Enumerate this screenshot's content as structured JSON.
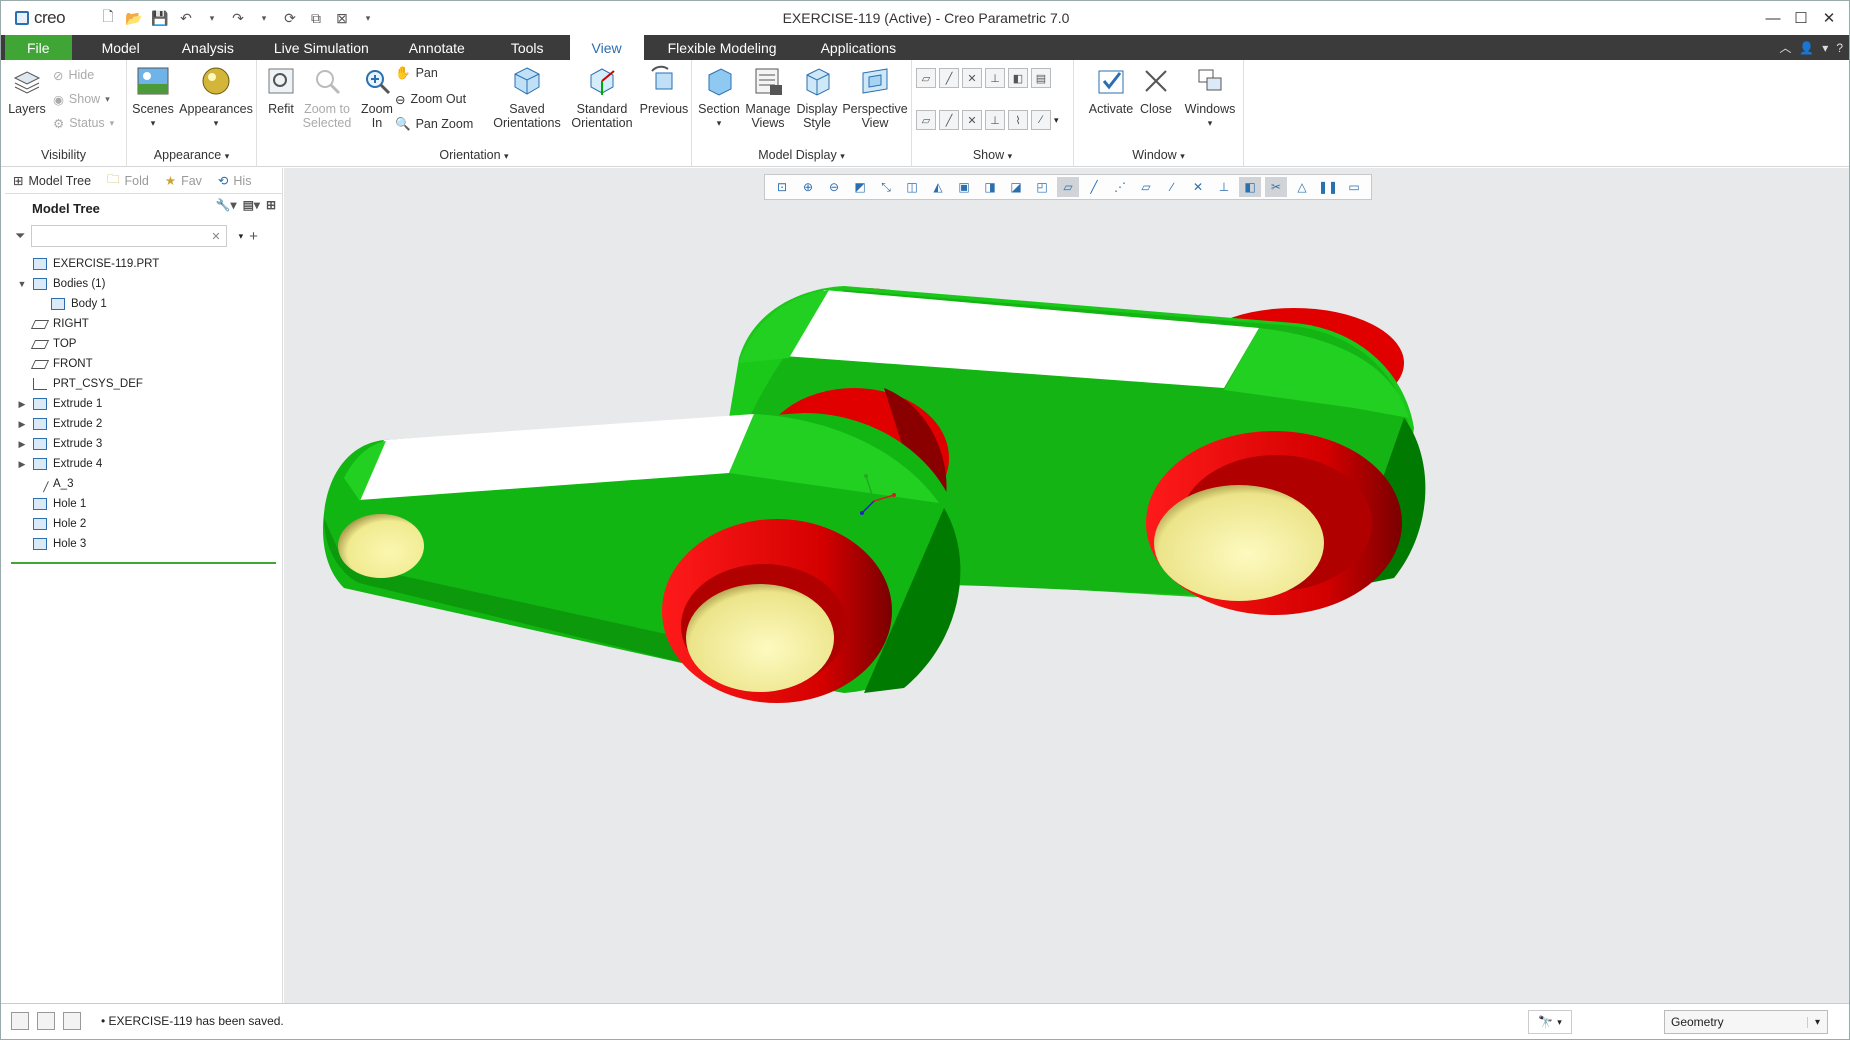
{
  "app": {
    "logo": "creo",
    "title": "EXERCISE-119 (Active) - Creo Parametric 7.0"
  },
  "ribbon_tabs": [
    "File",
    "Model",
    "Analysis",
    "Live Simulation",
    "Annotate",
    "Tools",
    "View",
    "Flexible Modeling",
    "Applications"
  ],
  "active_tab": "View",
  "ribbon": {
    "visibility": {
      "layers": "Layers",
      "hide": "Hide",
      "show": "Show",
      "status": "Status",
      "group": "Visibility"
    },
    "appearance": {
      "scenes": "Scenes",
      "appearances": "Appearances",
      "group": "Appearance"
    },
    "orientation": {
      "refit": "Refit",
      "zoom_to_selected": "Zoom to Selected",
      "zoom_in": "Zoom In",
      "pan": "Pan",
      "zoom_out": "Zoom Out",
      "pan_zoom": "Pan Zoom",
      "saved_orientations": "Saved Orientations",
      "standard_orientation": "Standard Orientation",
      "previous": "Previous",
      "group": "Orientation"
    },
    "model_display": {
      "section": "Section",
      "manage_views": "Manage Views",
      "display_style": "Display Style",
      "perspective_view": "Perspective View",
      "group": "Model Display"
    },
    "show": {
      "group": "Show"
    },
    "window": {
      "activate": "Activate",
      "close": "Close",
      "windows": "Windows",
      "group": "Window"
    }
  },
  "panel_tabs": [
    "Model Tree",
    "Fold",
    "Fav",
    "His"
  ],
  "model_tree": {
    "header": "Model Tree",
    "items": [
      {
        "label": "EXERCISE-119.PRT",
        "level": 0,
        "expander": "",
        "icon": "part-icon"
      },
      {
        "label": "Bodies (1)",
        "level": 0,
        "expander": "▼",
        "icon": "bodies-icon"
      },
      {
        "label": "Body 1",
        "level": 1,
        "expander": "",
        "icon": "body-icon"
      },
      {
        "label": "RIGHT",
        "level": 0,
        "expander": "",
        "icon": "datum-plane-icon"
      },
      {
        "label": "TOP",
        "level": 0,
        "expander": "",
        "icon": "datum-plane-icon"
      },
      {
        "label": "FRONT",
        "level": 0,
        "expander": "",
        "icon": "datum-plane-icon"
      },
      {
        "label": "PRT_CSYS_DEF",
        "level": 0,
        "expander": "",
        "icon": "csys-icon"
      },
      {
        "label": "Extrude 1",
        "level": 0,
        "expander": "▶",
        "icon": "extrude-icon"
      },
      {
        "label": "Extrude 2",
        "level": 0,
        "expander": "▶",
        "icon": "extrude-icon"
      },
      {
        "label": "Extrude 3",
        "level": 0,
        "expander": "▶",
        "icon": "extrude-icon"
      },
      {
        "label": "Extrude 4",
        "level": 0,
        "expander": "▶",
        "icon": "extrude-icon"
      },
      {
        "label": "A_3",
        "level": 0,
        "expander": "",
        "icon": "axis-icon"
      },
      {
        "label": "Hole 1",
        "level": 0,
        "expander": "",
        "icon": "hole-icon"
      },
      {
        "label": "Hole 2",
        "level": 0,
        "expander": "",
        "icon": "hole-icon"
      },
      {
        "label": "Hole 3",
        "level": 0,
        "expander": "",
        "icon": "hole-icon"
      }
    ]
  },
  "status": {
    "message": "EXERCISE-119 has been saved.",
    "filter_value": "Geometry"
  },
  "colors": {
    "file_tab": "#3fa535",
    "tabbar": "#3b3b3b",
    "part_green": "#1fcc1f",
    "part_red": "#dd0000",
    "hole_yellow": "#f4f09a",
    "viewport_bg": "#e8e9eb"
  }
}
